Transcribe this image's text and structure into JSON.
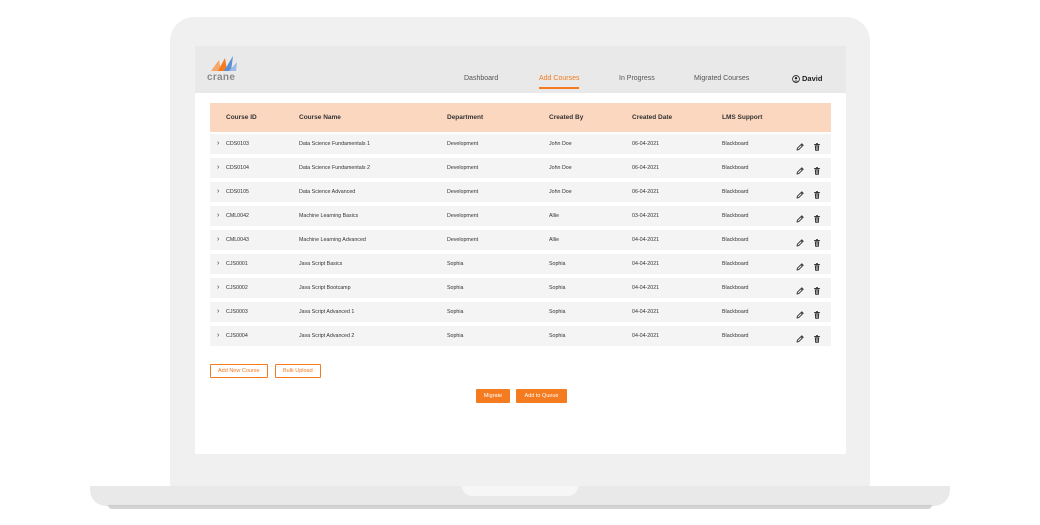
{
  "app": {
    "logo_text": "crane",
    "user_name": "David",
    "user_icon": "user-circle-icon"
  },
  "nav": [
    {
      "label": "Dashboard",
      "active": false
    },
    {
      "label": "Add Courses",
      "active": true
    },
    {
      "label": "In Progress",
      "active": false
    },
    {
      "label": "Migrated Courses",
      "active": false
    }
  ],
  "table": {
    "columns": [
      "Course ID",
      "Course Name",
      "Department",
      "Created By",
      "Created Date",
      "LMS Support"
    ],
    "rows": [
      {
        "id": "CDS0103",
        "name": "Data Science Fundamentals 1",
        "department": "Development",
        "created_by": "John Doe",
        "created_date": "06-04-2021",
        "lms": "Blackboard"
      },
      {
        "id": "CDS0104",
        "name": "Data Science Fundamentals 2",
        "department": "Development",
        "created_by": "John Doe",
        "created_date": "06-04-2021",
        "lms": "Blackboard"
      },
      {
        "id": "CDS0105",
        "name": "Data Science Advanced",
        "department": "Development",
        "created_by": "John Doe",
        "created_date": "06-04-2021",
        "lms": "Blackboard"
      },
      {
        "id": "CML0042",
        "name": "Machine Learning Basics",
        "department": "Development",
        "created_by": "Allie",
        "created_date": "03-04-2021",
        "lms": "Blackboard"
      },
      {
        "id": "CML0043",
        "name": "Machine Learning Advanced",
        "department": "Development",
        "created_by": "Allie",
        "created_date": "04-04-2021",
        "lms": "Blackboard"
      },
      {
        "id": "CJS0001",
        "name": "Java Script Basics",
        "department": "Sophia",
        "created_by": "Sophia",
        "created_date": "04-04-2021",
        "lms": "Blackboard"
      },
      {
        "id": "CJS0002",
        "name": "Java Script Bootcamp",
        "department": "Sophia",
        "created_by": "Sophia",
        "created_date": "04-04-2021",
        "lms": "Blackboard"
      },
      {
        "id": "CJS0003",
        "name": "Java Script Advanced 1",
        "department": "Sophia",
        "created_by": "Sophia",
        "created_date": "04-04-2021",
        "lms": "Blackboard"
      },
      {
        "id": "CJS0004",
        "name": "Java Script Advanced 2",
        "department": "Sophia",
        "created_by": "Sophia",
        "created_date": "04-04-2021",
        "lms": "Blackboard"
      }
    ],
    "row_icons": {
      "expand": "chevron-right-icon",
      "edit": "pencil-icon",
      "delete": "trash-icon"
    }
  },
  "buttons": {
    "add_new_course": "Add New Course",
    "bulk_upload": "Bulk Upload",
    "migrate": "Migrate",
    "add_to_queue": "Add to Queue"
  },
  "colors": {
    "accent": "#f47b20",
    "header_row": "#fcd7bf",
    "row_bg": "#f4f4f4",
    "topbar_bg": "#e9e9e9"
  }
}
